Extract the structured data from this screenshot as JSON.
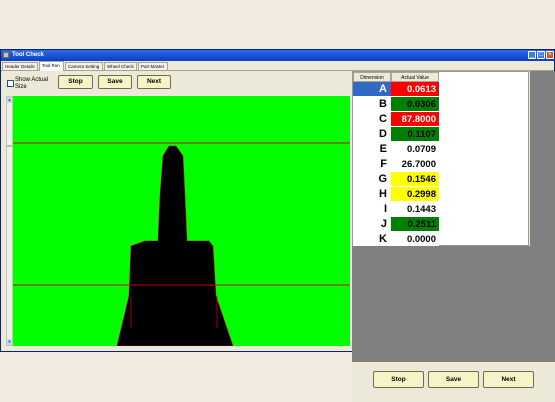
{
  "window": {
    "title": "Tool Check"
  },
  "tabs": [
    {
      "label": "Header Details"
    },
    {
      "label": "Tool Run"
    },
    {
      "label": "Camera Setting"
    },
    {
      "label": "Wheel Check"
    },
    {
      "label": "Part Master"
    }
  ],
  "controls": {
    "show_actual_size": "Show Actual Size",
    "stop": "Stop",
    "save": "Save",
    "next": "Next"
  },
  "bottom_buttons": {
    "stop": "Stop",
    "save": "Save",
    "next": "Next"
  },
  "table": {
    "headers": [
      "Dimension",
      "Actual Value"
    ],
    "rows": [
      {
        "label": "A",
        "value": "0.0613",
        "bg": "#ff0000",
        "fg": "#ffffff",
        "label_bg": "#316ac5",
        "label_fg": "#ffffff"
      },
      {
        "label": "B",
        "value": "0.0306",
        "bg": "#008000",
        "fg": "#000000"
      },
      {
        "label": "C",
        "value": "87.8000",
        "bg": "#ff0000",
        "fg": "#ffffff"
      },
      {
        "label": "D",
        "value": "0.1107",
        "bg": "#008000",
        "fg": "#000000"
      },
      {
        "label": "E",
        "value": "0.0709",
        "bg": "#ffffff",
        "fg": "#000000"
      },
      {
        "label": "F",
        "value": "26.7000",
        "bg": "#ffffff",
        "fg": "#000000"
      },
      {
        "label": "G",
        "value": "0.1546",
        "bg": "#ffff00",
        "fg": "#000000"
      },
      {
        "label": "H",
        "value": "0.2998",
        "bg": "#ffff00",
        "fg": "#000000"
      },
      {
        "label": "I",
        "value": "0.1443",
        "bg": "#ffffff",
        "fg": "#000000"
      },
      {
        "label": "J",
        "value": "0.2511",
        "bg": "#008000",
        "fg": "#000000"
      },
      {
        "label": "K",
        "value": "0.0000",
        "bg": "#ffffff",
        "fg": "#000000"
      }
    ]
  },
  "colors": {
    "canvas_bg": "#00ff00",
    "tool_silhouette": "#000000",
    "reference_lines": "#cc0000"
  }
}
